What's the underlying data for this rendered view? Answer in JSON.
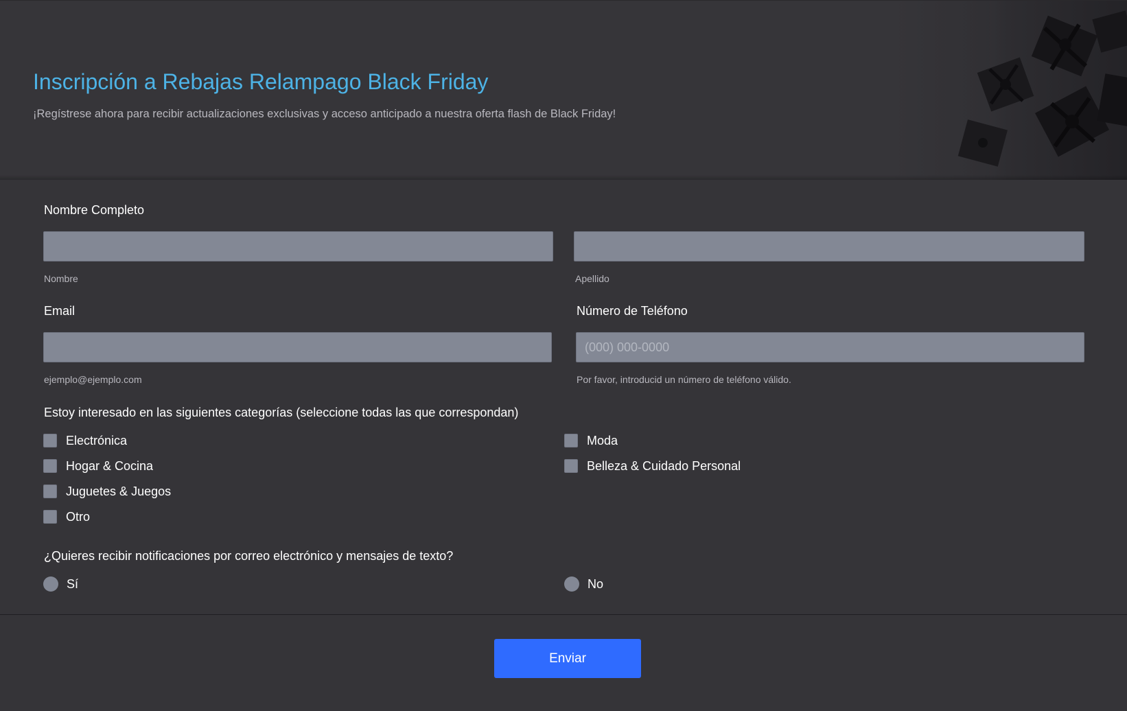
{
  "header": {
    "title": "Inscripción a Rebajas Relampago Black Friday",
    "subtitle": "¡Regístrese ahora para recibir actualizaciones exclusivas y acceso anticipado a nuestra oferta flash de Black Friday!",
    "image_icon": "gift-boxes-image"
  },
  "colors": {
    "title": "#4db3e6",
    "background": "#353438",
    "input": "#838895",
    "button": "#2f6bff"
  },
  "form": {
    "full_name": {
      "label": "Nombre Completo",
      "first_name": {
        "value": "",
        "sublabel": "Nombre"
      },
      "last_name": {
        "value": "",
        "sublabel": "Apellido"
      }
    },
    "email": {
      "label": "Email",
      "value": "",
      "sublabel": "ejemplo@ejemplo.com"
    },
    "phone": {
      "label": "Número de Teléfono",
      "value": "",
      "placeholder": "(000) 000-0000",
      "sublabel": "Por favor, introducid un número de teléfono válido."
    },
    "categories": {
      "label": "Estoy interesado en las siguientes categorías (seleccione todas las que correspondan)",
      "options": [
        {
          "label": "Electrónica",
          "checked": false
        },
        {
          "label": "Hogar & Cocina",
          "checked": false
        },
        {
          "label": "Juguetes & Juegos",
          "checked": false
        },
        {
          "label": "Otro",
          "checked": false
        },
        {
          "label": "Moda",
          "checked": false
        },
        {
          "label": "Belleza & Cuidado Personal",
          "checked": false
        }
      ]
    },
    "notifications": {
      "label": "¿Quieres recibir notificaciones por correo electrónico y mensajes de texto?",
      "options": [
        {
          "label": "Sí",
          "selected": false
        },
        {
          "label": "No",
          "selected": false
        }
      ]
    }
  },
  "footer": {
    "submit_label": "Enviar"
  }
}
